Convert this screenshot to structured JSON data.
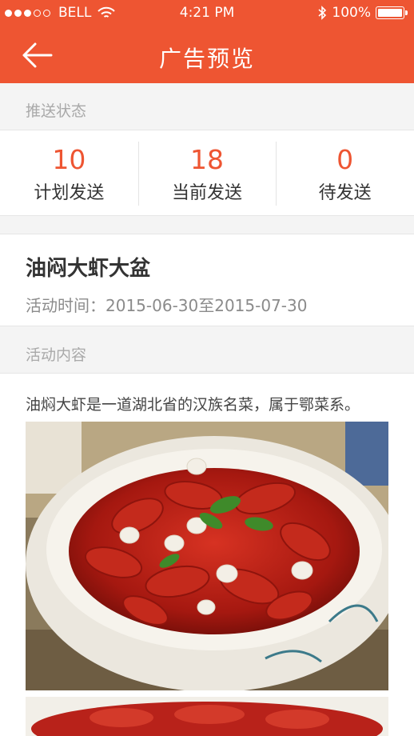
{
  "status_bar": {
    "carrier": "BELL",
    "time": "4:21 PM",
    "battery": "100%"
  },
  "nav": {
    "title": "广告预览"
  },
  "push_status": {
    "label": "推送状态",
    "stats": [
      {
        "value": "10",
        "label": "计划发送"
      },
      {
        "value": "18",
        "label": "当前发送"
      },
      {
        "value": "0",
        "label": "待发送"
      }
    ]
  },
  "ad": {
    "title": "油闷大虾大盆",
    "time_label": "活动时间：",
    "time_range": "2015-06-30至2015-07-30"
  },
  "content": {
    "label": "活动内容",
    "text": "油焖大虾是一道湖北省的汉族名菜，属于鄂菜系。"
  },
  "colors": {
    "accent": "#ee5532",
    "crayfish": "#c7231b"
  }
}
